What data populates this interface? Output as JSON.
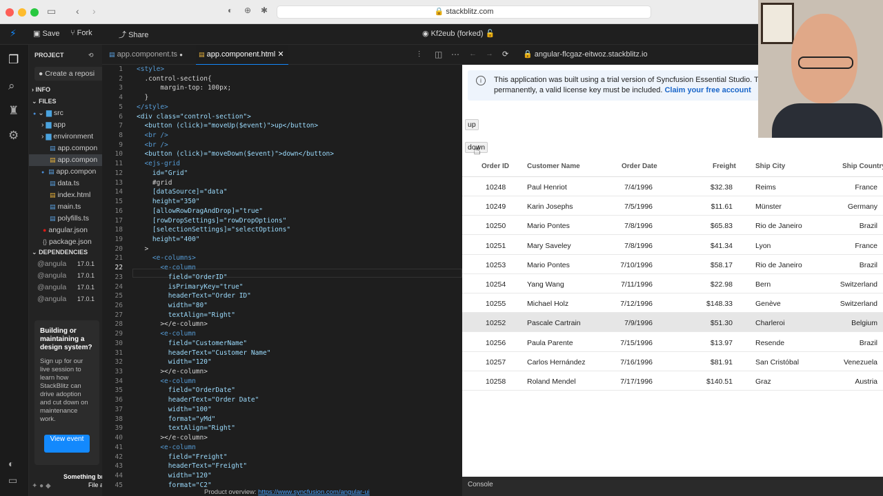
{
  "browser": {
    "url": "stackblitz.com"
  },
  "toolbar": {
    "save": "Save",
    "fork": "Fork",
    "share": "Share",
    "project_name": "Kf2eub (forked)"
  },
  "sidebar": {
    "project_label": "PROJECT",
    "create_repo": "Create a reposi",
    "info": "INFO",
    "files": "FILES",
    "tree": [
      "src",
      "app",
      "environment",
      "app.compon",
      "app.compon",
      "app.compon",
      "data.ts",
      "index.html",
      "main.ts",
      "polyfills.ts",
      "angular.json",
      "package.json"
    ],
    "dependencies": "DEPENDENCIES",
    "deps": [
      {
        "name": "@angula",
        "ver": "17.0.1"
      },
      {
        "name": "@angula",
        "ver": "17.0.1"
      },
      {
        "name": "@angula",
        "ver": "17.0.1"
      },
      {
        "name": "@angula",
        "ver": "17.0.1"
      }
    ],
    "promo_title": "Building or maintaining a design system?",
    "promo_body": "Sign up for our live session to learn how StackBlitz can drive adoption and cut down on maintenance work.",
    "promo_button": "View event",
    "bottom_text": "Something bro",
    "bottom_text2": "File a"
  },
  "editor": {
    "tabs": [
      "app.component.ts",
      "app.component.html"
    ],
    "line_numbers": [
      "1",
      "2",
      "3",
      "4",
      "5",
      "6",
      "7",
      "8",
      "9",
      "10",
      "11",
      "12",
      "13",
      "14",
      "15",
      "16",
      "17",
      "18",
      "19",
      "20",
      "21",
      "22",
      "23",
      "24",
      "25",
      "26",
      "27",
      "28",
      "29",
      "30",
      "31",
      "32",
      "33",
      "34",
      "35",
      "36",
      "37",
      "38",
      "39",
      "40",
      "41",
      "42",
      "43",
      "44",
      "45"
    ],
    "lines": [
      "<style>",
      "  .control-section{",
      "      margin-top: 100px;",
      "  }",
      "</style>",
      "<div class=\"control-section\">",
      "  <button (click)=\"moveUp($event)\">up</button>",
      "  <br />",
      "  <br />",
      "  <button (click)=\"moveDown($event)\">down</button>",
      "  <ejs-grid",
      "    id=\"Grid\"",
      "    #grid",
      "    [dataSource]=\"data\"",
      "    height=\"350\"",
      "    [allowRowDragAndDrop]=\"true\"",
      "    [rowDropSettings]=\"rowDropOptions\"",
      "    [selectionSettings]=\"selectOptions\"",
      "    height=\"400\"",
      "  >",
      "    <e-columns>",
      "      <e-column",
      "        field=\"OrderID\"",
      "        isPrimaryKey=\"true\"",
      "        headerText=\"Order ID\"",
      "        width=\"80\"",
      "        textAlign=\"Right\"",
      "      ></e-column>",
      "      <e-column",
      "        field=\"CustomerName\"",
      "        headerText=\"Customer Name\"",
      "        width=\"120\"",
      "      ></e-column>",
      "      <e-column",
      "        field=\"OrderDate\"",
      "        headerText=\"Order Date\"",
      "        width=\"100\"",
      "        format=\"yMd\"",
      "        textAlign=\"Right\"",
      "      ></e-column>",
      "      <e-column",
      "        field=\"Freight\"",
      "        headerText=\"Freight\"",
      "        width=\"120\"",
      "        format=\"C2\""
    ],
    "footer_text": "Product overview: ",
    "footer_link": "https://www.syncfusion.com/angular-ui"
  },
  "preview": {
    "url": "angular-flcgaz-eitwoz.stackblitz.io",
    "banner_text": "This application was built using a trial version of Syncfusion Essential Studio. To",
    "banner_text2": "permanently, a valid license key must be included.",
    "banner_link": "Claim your free account",
    "button_up": "up",
    "button_down": "down",
    "columns": [
      "Order ID",
      "Customer Name",
      "Order Date",
      "Freight",
      "Ship City",
      "Ship Country"
    ],
    "rows": [
      [
        "10248",
        "Paul Henriot",
        "7/4/1996",
        "$32.38",
        "Reims",
        "France"
      ],
      [
        "10249",
        "Karin Josephs",
        "7/5/1996",
        "$11.61",
        "Münster",
        "Germany"
      ],
      [
        "10250",
        "Mario Pontes",
        "7/8/1996",
        "$65.83",
        "Rio de Janeiro",
        "Brazil"
      ],
      [
        "10251",
        "Mary Saveley",
        "7/8/1996",
        "$41.34",
        "Lyon",
        "France"
      ],
      [
        "10253",
        "Mario Pontes",
        "7/10/1996",
        "$58.17",
        "Rio de Janeiro",
        "Brazil"
      ],
      [
        "10254",
        "Yang Wang",
        "7/11/1996",
        "$22.98",
        "Bern",
        "Switzerland"
      ],
      [
        "10255",
        "Michael Holz",
        "7/12/1996",
        "$148.33",
        "Genève",
        "Switzerland"
      ],
      [
        "10252",
        "Pascale Cartrain",
        "7/9/1996",
        "$51.30",
        "Charleroi",
        "Belgium"
      ],
      [
        "10256",
        "Paula Parente",
        "7/15/1996",
        "$13.97",
        "Resende",
        "Brazil"
      ],
      [
        "10257",
        "Carlos Hernández",
        "7/16/1996",
        "$81.91",
        "San Cristóbal",
        "Venezuela"
      ],
      [
        "10258",
        "Roland Mendel",
        "7/17/1996",
        "$140.51",
        "Graz",
        "Austria"
      ]
    ],
    "console": "Console"
  },
  "colors": {
    "accent": "#1389fd",
    "link": "#1a66c9"
  }
}
